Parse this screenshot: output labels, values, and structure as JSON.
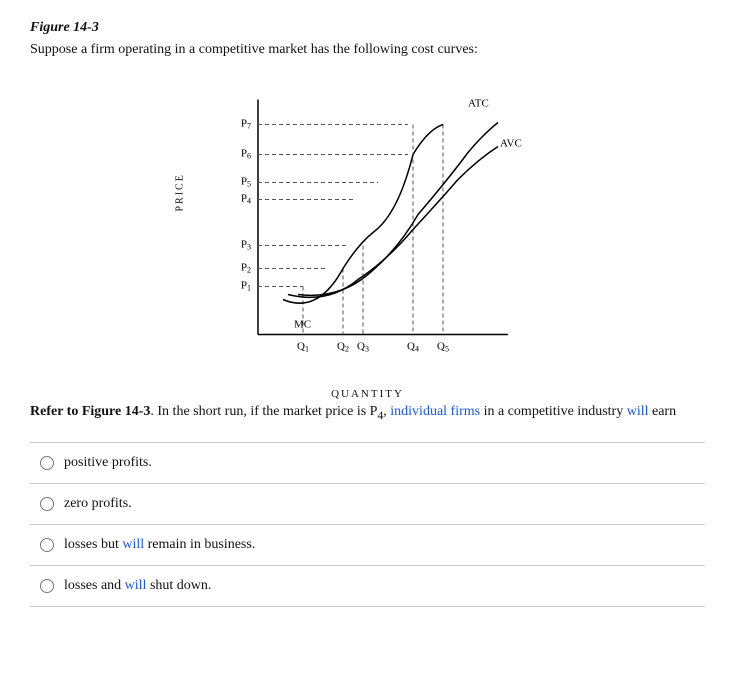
{
  "figure": {
    "label": "Figure 14-3",
    "description": "Suppose a firm operating in a competitive market has the following cost curves:",
    "chart": {
      "y_axis_label": "PRICE",
      "x_axis_label": "QUANTITY",
      "curves": {
        "ATC": "ATC",
        "AVC": "AVC",
        "MC": "MC"
      },
      "prices": [
        "P7",
        "P6",
        "P5",
        "P4",
        "P3",
        "P2",
        "P1"
      ],
      "quantities": [
        "Q1",
        "Q2",
        "Q3",
        "Q4",
        "Q5"
      ]
    }
  },
  "question": {
    "reference": "Refer to Figure 14-3",
    "text": ". In the short run, if the market price is P",
    "subscript": "4",
    "text2": ", individual firms in a competitive industry will earn"
  },
  "options": [
    {
      "id": "opt1",
      "text": "positive profits."
    },
    {
      "id": "opt2",
      "text": "zero profits."
    },
    {
      "id": "opt3",
      "text_before": "losses but ",
      "blue": "will",
      "text_after": " remain in business."
    },
    {
      "id": "opt4",
      "text_before": "losses and ",
      "blue": "will",
      "text_after": " shut down."
    }
  ]
}
